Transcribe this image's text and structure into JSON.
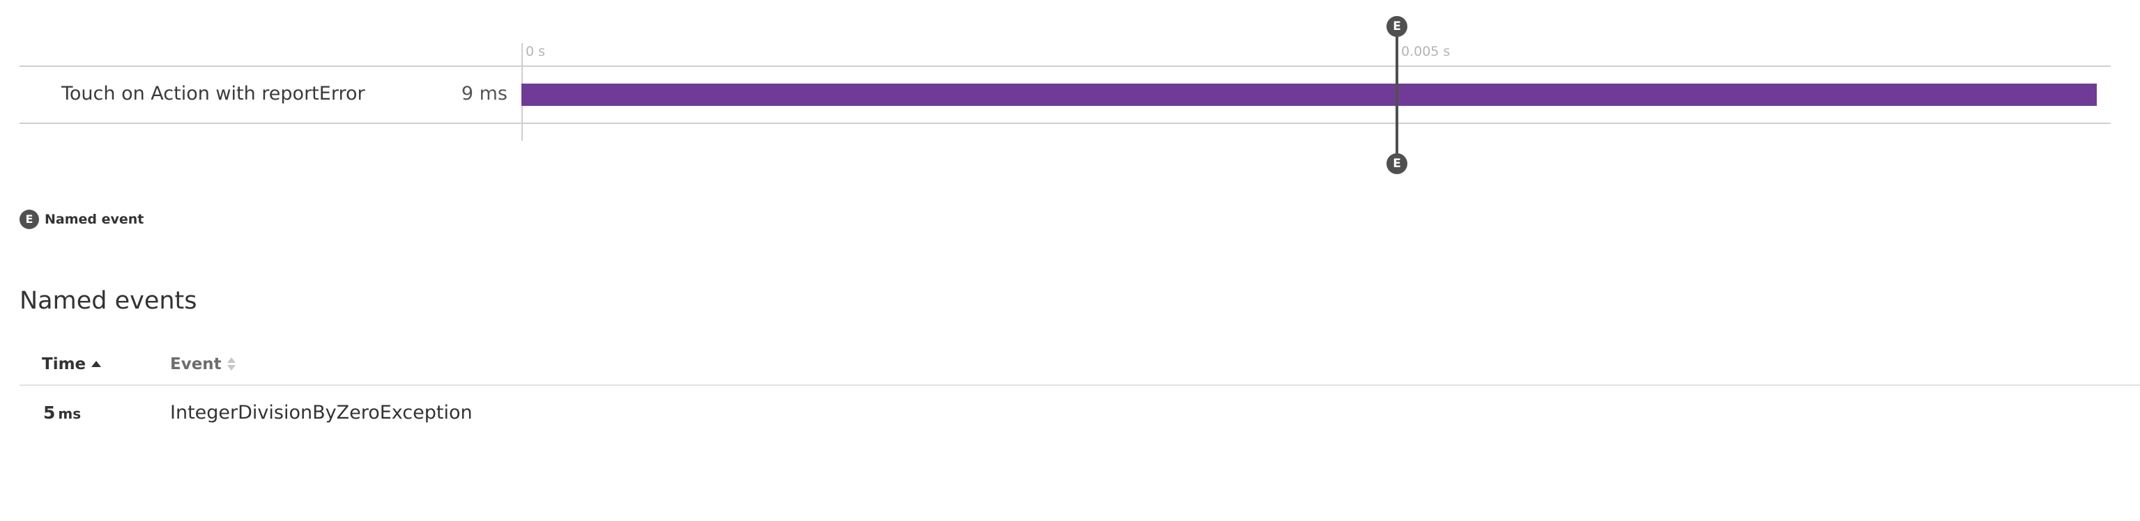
{
  "timeline": {
    "ticks": [
      "0 s",
      "0.005 s"
    ],
    "rows": [
      {
        "label": "Touch on Action with reportError",
        "duration": "9 ms",
        "bar_fraction": 1.0,
        "bar_color": "#6f3b97"
      }
    ],
    "event_marker": {
      "badge": "E",
      "time_ms": 5
    }
  },
  "legend": {
    "badge": "E",
    "label": "Named event"
  },
  "named_events": {
    "title": "Named events",
    "columns": {
      "time": "Time",
      "event": "Event"
    },
    "sort": {
      "time": "ascending",
      "event": "none"
    },
    "rows": [
      {
        "time_value": "5",
        "time_unit": "ms",
        "event": "IntegerDivisionByZeroException"
      }
    ]
  },
  "colors": {
    "bar": "#6f3b97",
    "marker": "#505050",
    "gridline": "#cfcfcf"
  }
}
